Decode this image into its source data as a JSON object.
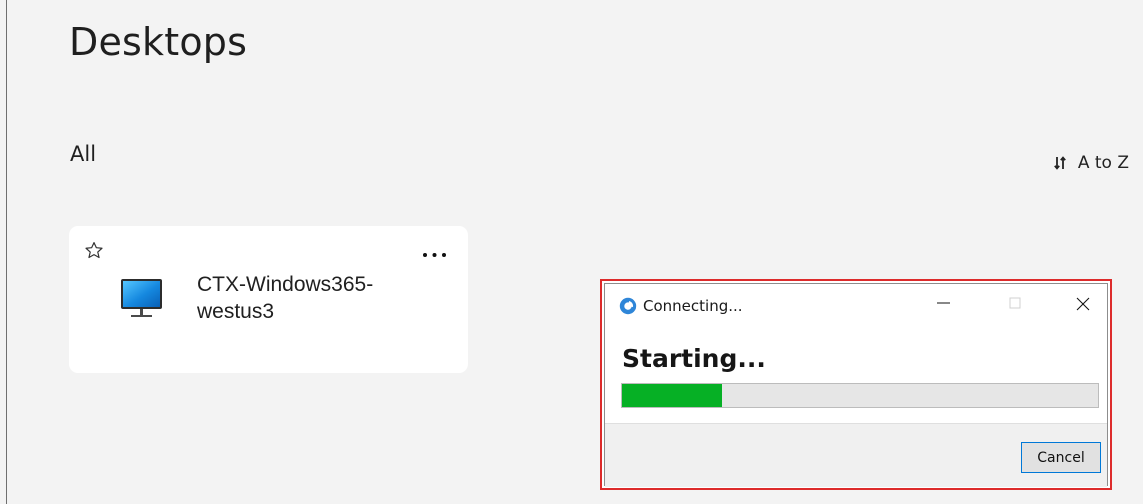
{
  "page": {
    "title": "Desktops",
    "section": "All",
    "sort": {
      "label": "A to Z",
      "icon": "sort-icon"
    }
  },
  "desktops": [
    {
      "name": "CTX-Windows365-westus3",
      "display_lines": [
        "CTX-Windows365-",
        "westus3"
      ],
      "favorite_icon": "star-outline-icon",
      "monitor_icon": "monitor-icon",
      "more_icon": "more-options-icon"
    }
  ],
  "dialog": {
    "title": "Connecting...",
    "status": "Starting...",
    "progress": 0.21,
    "cancel_label": "Cancel",
    "window_controls": [
      "minimize",
      "maximize",
      "close"
    ],
    "icon": "citrix-icon"
  },
  "colors": {
    "background": "#f3f3f3",
    "card": "#ffffff",
    "progress": "#06b025",
    "dialog_highlight": "#dd2b2b",
    "button_focus": "#0078d7"
  }
}
